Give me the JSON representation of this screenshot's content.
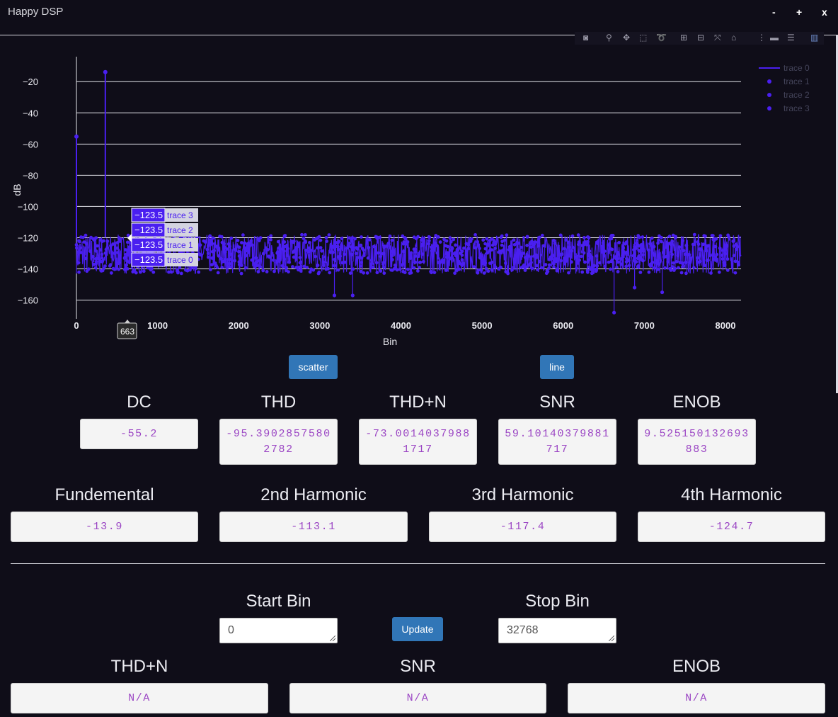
{
  "app": {
    "title": "Happy DSP",
    "minimize": "-",
    "maximize": "+",
    "close": "x"
  },
  "modebar": {
    "icons": [
      "camera-icon",
      "zoom-icon",
      "pan-icon",
      "box-select-icon",
      "lasso-icon",
      "zoom-in-icon",
      "zoom-out-icon",
      "autoscale-icon",
      "home-icon",
      "spike-lines-icon",
      "hover-closest-icon",
      "hover-compare-icon",
      "plotly-logo-icon"
    ]
  },
  "chart_data": {
    "type": "line",
    "xlabel": "Bin",
    "ylabel": "dB",
    "xlim": [
      0,
      8192
    ],
    "ylim": [
      -172,
      -4
    ],
    "grid": true,
    "legend_placement": "top-right",
    "x_ticks": [
      "0",
      "1000",
      "2000",
      "3000",
      "4000",
      "5000",
      "6000",
      "7000",
      "8000"
    ],
    "y_ticks": [
      "−20",
      "−40",
      "−60",
      "−80",
      "−100",
      "−120",
      "−140",
      "−160"
    ],
    "series": [
      {
        "name": "trace 0",
        "mode": "lines",
        "color": "#4a1ff0"
      },
      {
        "name": "trace 1",
        "mode": "markers",
        "color": "#4a1ff0"
      },
      {
        "name": "trace 2",
        "mode": "markers",
        "color": "#4a1ff0"
      },
      {
        "name": "trace 3",
        "mode": "markers",
        "color": "#4a1ff0"
      }
    ],
    "peaks": [
      {
        "x": 0,
        "y": -55.2
      },
      {
        "x": 356,
        "y": -13.9
      }
    ],
    "noise_floor": {
      "x_start": 0,
      "x_end": 8192,
      "y_min": -143,
      "y_max": -118
    },
    "outliers": [
      {
        "x": 3180,
        "y": -157
      },
      {
        "x": 3405,
        "y": -157
      },
      {
        "x": 6627,
        "y": -168
      },
      {
        "x": 6880,
        "y": -152
      },
      {
        "x": 7220,
        "y": -155
      }
    ],
    "hover": {
      "x_label": "663",
      "items": [
        {
          "value": "−123.5",
          "name": "trace 3"
        },
        {
          "value": "−123.5",
          "name": "trace 2"
        },
        {
          "value": "−123.5",
          "name": "trace 1"
        },
        {
          "value": "−123.5",
          "name": "trace 0"
        }
      ]
    }
  },
  "buttons": {
    "scatter": "scatter",
    "line": "line",
    "update": "Update"
  },
  "metrics": {
    "dc": {
      "label": "DC",
      "value": "-55.2"
    },
    "thd": {
      "label": "THD",
      "value": "-95.39028575802782"
    },
    "thdn": {
      "label": "THD+N",
      "value": "-73.00140379881717"
    },
    "snr": {
      "label": "SNR",
      "value": "59.10140379881717"
    },
    "enob": {
      "label": "ENOB",
      "value": "9.525150132693883"
    }
  },
  "harmonics": {
    "fundamental": {
      "label": "Fundemental",
      "value": "-13.9"
    },
    "h2": {
      "label": "2nd Harmonic",
      "value": "-113.1"
    },
    "h3": {
      "label": "3rd Harmonic",
      "value": "-117.4"
    },
    "h4": {
      "label": "4th Harmonic",
      "value": "-124.7"
    }
  },
  "range": {
    "start_label": "Start Bin",
    "start_value": "0",
    "stop_label": "Stop Bin",
    "stop_value": "32768"
  },
  "range_metrics": {
    "thdn": {
      "label": "THD+N",
      "value": "N/A"
    },
    "snr": {
      "label": "SNR",
      "value": "N/A"
    },
    "enob": {
      "label": "ENOB",
      "value": "N/A"
    }
  }
}
